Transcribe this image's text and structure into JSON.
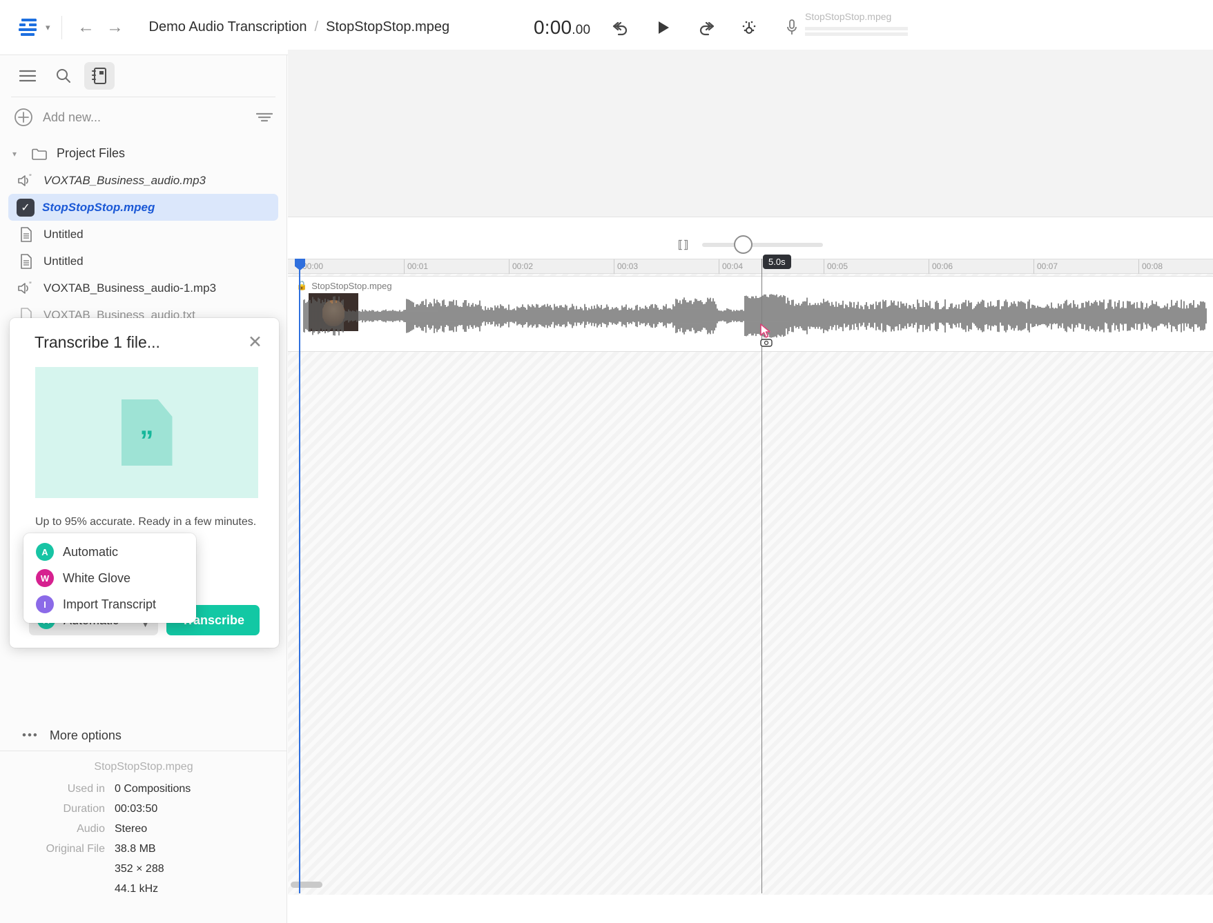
{
  "header": {
    "logo_name": "app-logo",
    "breadcrumb": {
      "project": "Demo Audio Transcription",
      "separator": "/",
      "file": "StopStopStop.mpeg"
    },
    "transport": {
      "timecode_main": "0:00",
      "timecode_frac": ".00",
      "undo_label": "Undo",
      "play_label": "Play",
      "redo_label": "Redo",
      "ai_label": "AI tools",
      "mic_label": "Record"
    },
    "monitor_file": "StopStopStop.mpeg"
  },
  "sidebar": {
    "tools": [
      {
        "name": "menu-icon",
        "label": "Menu"
      },
      {
        "name": "search-icon",
        "label": "Search"
      },
      {
        "name": "script-icon",
        "label": "Script",
        "active": true
      }
    ],
    "add_new_label": "Add new...",
    "filter_label": "Filter",
    "tree": [
      {
        "type": "folder",
        "label": "Project Files",
        "expanded": true
      },
      {
        "type": "audio",
        "label": "VOXTAB_Business_audio.mp3",
        "italic": true
      },
      {
        "type": "selected-audio",
        "label": "StopStopStop.mpeg",
        "checked": true
      },
      {
        "type": "doc",
        "label": "Untitled"
      },
      {
        "type": "doc",
        "label": "Untitled"
      },
      {
        "type": "audio",
        "label": "VOXTAB_Business_audio-1.mp3"
      },
      {
        "type": "doc",
        "label": "VOXTAB_Business_audio.txt",
        "clipped": true
      }
    ]
  },
  "dialog": {
    "title": "Transcribe 1 file...",
    "close_label": "Close",
    "art_quote": "”",
    "note": "Up to 95% accurate. Ready in a few minutes.",
    "select_value": "Automatic",
    "select_badge": "A",
    "transcribe_button": "Transcribe",
    "options": [
      {
        "badge": "A",
        "label": "Automatic",
        "color": "#17c4a4"
      },
      {
        "badge": "W",
        "label": "White Glove",
        "color": "#d6218f"
      },
      {
        "badge": "I",
        "label": "Import Transcript",
        "color": "#8b6ae8"
      }
    ]
  },
  "more_options": {
    "label": "More options",
    "dots": "•••"
  },
  "meta": {
    "file_name": "StopStopStop.mpeg",
    "rows": [
      {
        "key": "Used in",
        "value": "0 Compositions"
      },
      {
        "key": "Duration",
        "value": "00:03:50"
      },
      {
        "key": "Audio",
        "value": "Stereo"
      },
      {
        "key": "Original File",
        "value": "38.8 MB"
      },
      {
        "key": "",
        "value": "352 × 288"
      },
      {
        "key": "",
        "value": "44.1 kHz"
      }
    ]
  },
  "timeline": {
    "zoom_icon": "horizontal-resize-icon",
    "zoom_value": 30,
    "ruler_ticks": [
      "00:00",
      "00:01",
      "00:02",
      "00:03",
      "00:04",
      "00:05",
      "00:06",
      "00:07",
      "00:08"
    ],
    "playhead_badge": "5.0s",
    "clip": {
      "name": "StopStopStop.mpeg",
      "locked": true
    }
  },
  "colors": {
    "accent_teal": "#12c8a4",
    "accent_blue": "#2f6fdd",
    "selection_blue": "#dbe7fb",
    "art_mint": "#d6f5ee",
    "logo_blue": "#1d6fe0"
  }
}
